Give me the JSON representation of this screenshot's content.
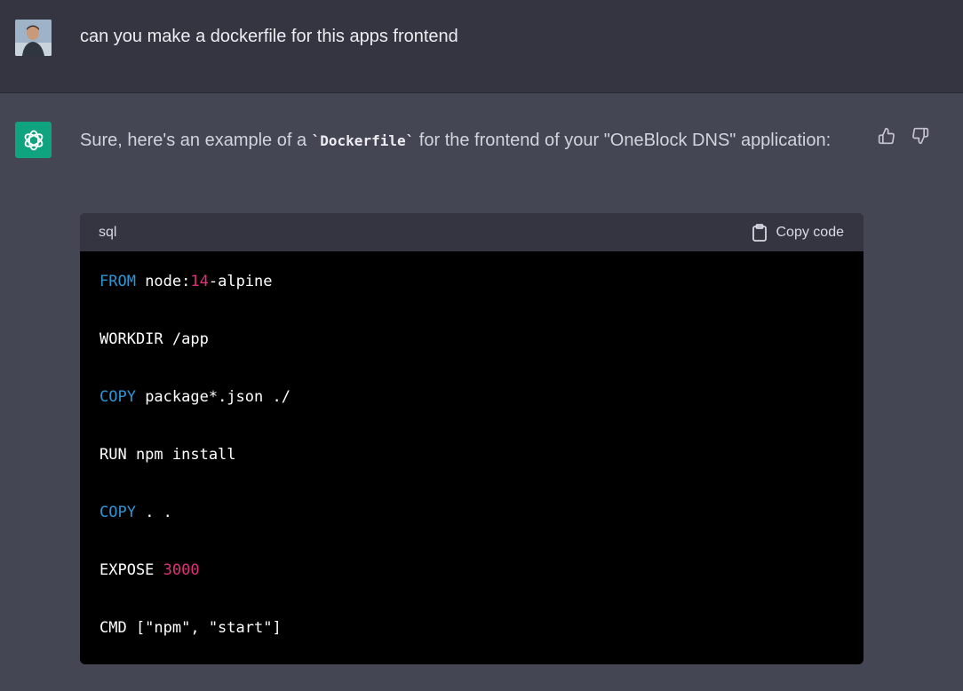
{
  "user_message": {
    "text": "can you make a dockerfile for this apps frontend",
    "avatar_icon": "user-avatar"
  },
  "assistant_message": {
    "avatar_icon": "openai-logo-icon",
    "text_before": "Sure, here's an example of a ",
    "code_inline": "`Dockerfile`",
    "text_after": " for the frontend of your \"OneBlock DNS\" application:",
    "feedback": {
      "thumbs_up_icon": "thumbs-up-icon",
      "thumbs_down_icon": "thumbs-down-icon"
    }
  },
  "code_block": {
    "language": "sql",
    "copy_label": "Copy code",
    "copy_icon": "clipboard-icon",
    "lines": [
      {
        "kw": "FROM",
        "rest1": " node:",
        "num": "14",
        "rest2": "-alpine"
      },
      {
        "plain": "WORKDIR /app"
      },
      {
        "kw": "COPY",
        "rest1": " package*.json ./"
      },
      {
        "plain": "RUN npm install"
      },
      {
        "kw": "COPY",
        "rest1": " . ."
      },
      {
        "plain": "EXPOSE ",
        "num": "3000"
      },
      {
        "plain": "CMD [\"npm\", \"start\"]"
      }
    ]
  },
  "colors": {
    "user_bg": "#343541",
    "assistant_bg": "#444654",
    "brand_green": "#10a37f",
    "keyword_blue": "#2e95d3",
    "number_pink": "#df3079"
  }
}
